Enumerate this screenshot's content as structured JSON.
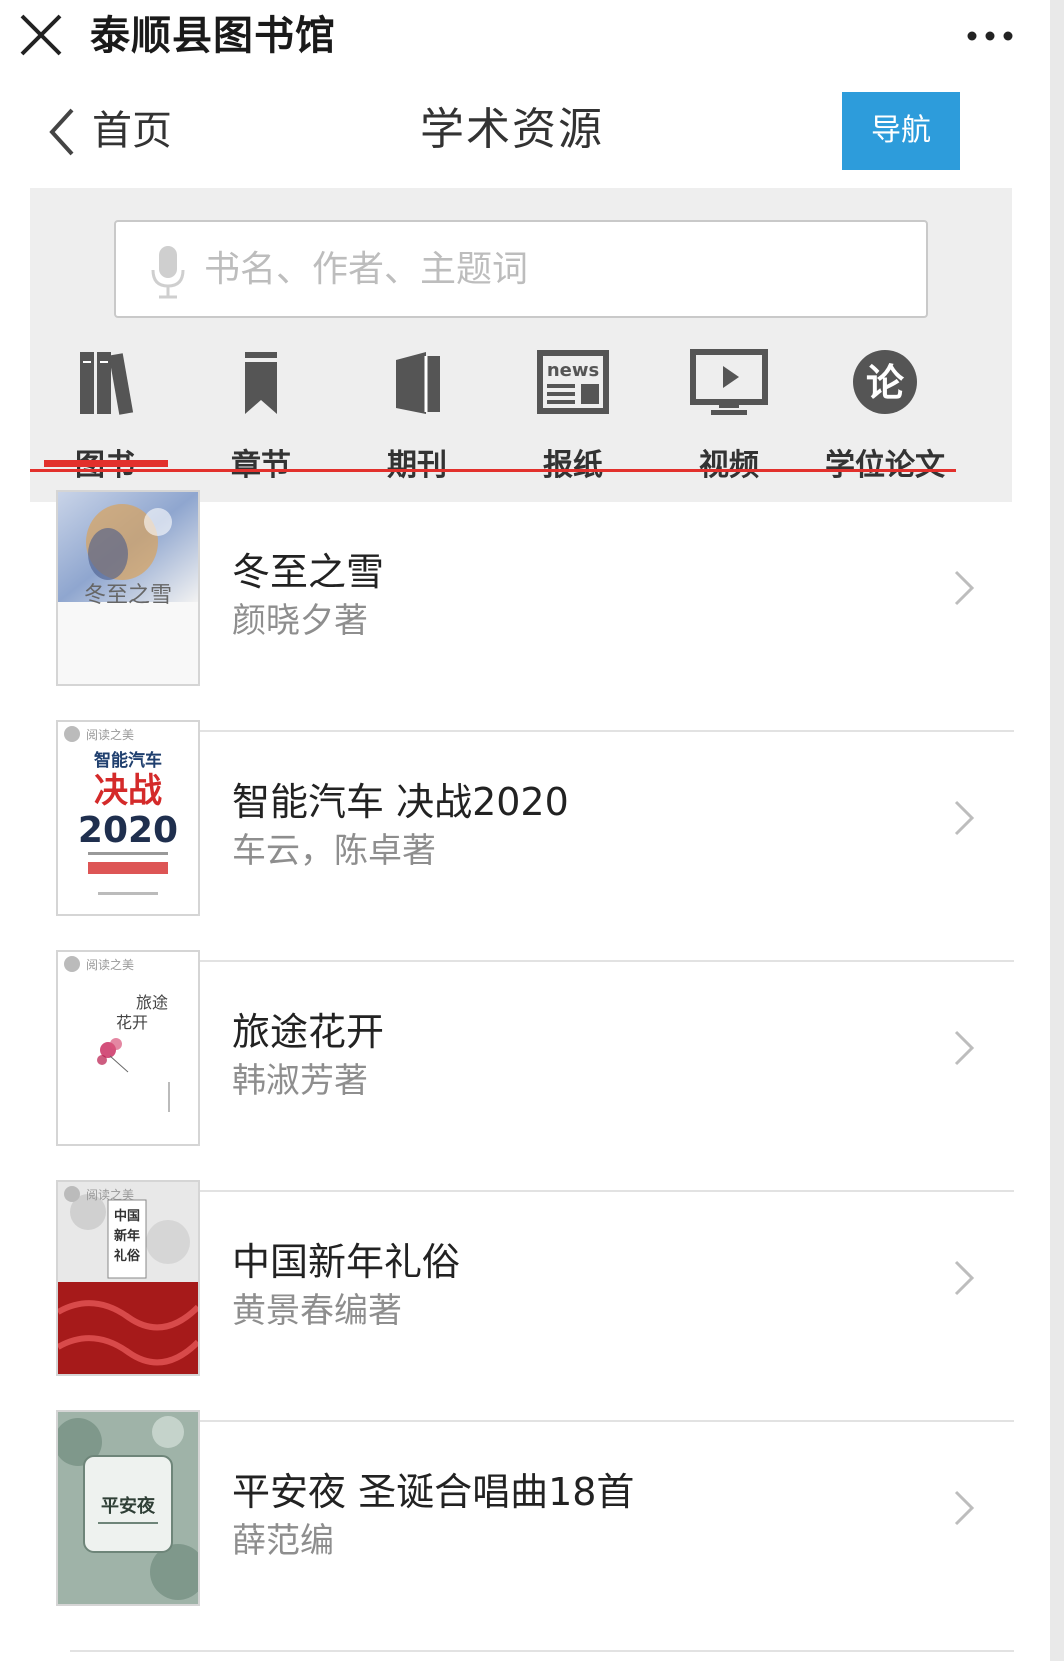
{
  "wechat": {
    "title": "泰顺县图书馆",
    "close_icon": "close-icon",
    "more_icon": "more-dots-icon"
  },
  "nav": {
    "back_label": "首页",
    "title": "学术资源",
    "nav_button": "导航"
  },
  "search": {
    "placeholder": "书名、作者、主题词",
    "icon": "microphone-icon"
  },
  "categories": [
    {
      "label": "图书",
      "icon": "books-icon",
      "active": true
    },
    {
      "label": "章节",
      "icon": "bookmark-icon",
      "active": false
    },
    {
      "label": "期刊",
      "icon": "journal-icon",
      "active": false
    },
    {
      "label": "报纸",
      "icon": "newspaper-icon",
      "news_text": "news",
      "active": false
    },
    {
      "label": "视频",
      "icon": "video-icon",
      "active": false
    },
    {
      "label": "学位论文",
      "icon": "thesis-icon",
      "badge": "论",
      "active": false
    }
  ],
  "books": [
    {
      "title": "冬至之雪",
      "author": "颜晓夕著",
      "cover_text": "冬至之雪"
    },
    {
      "title": "智能汽车 决战2020",
      "author": "车云，陈卓著",
      "cover_text": [
        "阅读之美",
        "智能汽车",
        "决战",
        "2020"
      ]
    },
    {
      "title": "旅途花开",
      "author": "韩淑芳著",
      "cover_text": [
        "阅读之美",
        "旅途",
        "花开"
      ]
    },
    {
      "title": "中国新年礼俗",
      "author": "黄景春编著",
      "cover_text": [
        "阅读之美",
        "中国",
        "新年",
        "礼俗"
      ]
    },
    {
      "title": "平安夜 圣诞合唱曲18首",
      "author": "薛范编",
      "cover_text": "平安夜"
    }
  ],
  "colors": {
    "accent_red": "#e2302c",
    "nav_button_blue": "#2d9cdb",
    "panel_gray": "#eeeeee"
  }
}
